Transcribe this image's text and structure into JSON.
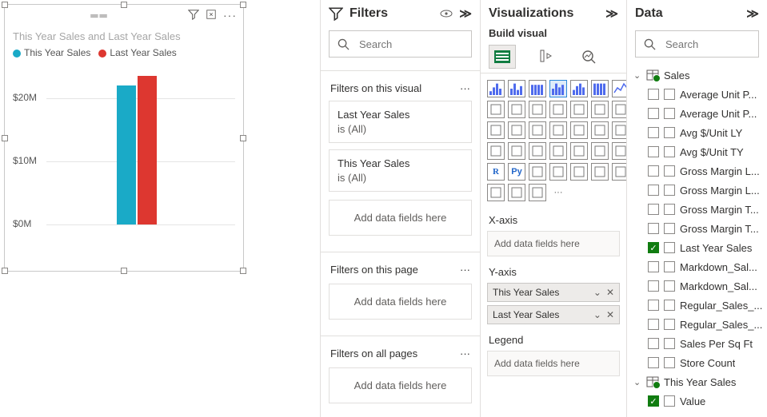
{
  "chart_data": {
    "type": "bar",
    "title": "This Year Sales and Last Year Sales",
    "series": [
      {
        "name": "This Year Sales",
        "values": [
          22
        ],
        "color": "#1aaac7"
      },
      {
        "name": "Last Year Sales",
        "values": [
          23.5
        ],
        "color": "#dd3730"
      }
    ],
    "categories": [
      ""
    ],
    "ylabel": "",
    "ylim": [
      0,
      25
    ],
    "yticks": [
      {
        "v": 0,
        "label": "$0M"
      },
      {
        "v": 10,
        "label": "$10M"
      },
      {
        "v": 20,
        "label": "$20M"
      }
    ]
  },
  "filters": {
    "pane_title": "Filters",
    "search_placeholder": "Search",
    "sections": {
      "visual": {
        "title": "Filters on this visual",
        "cards": [
          {
            "field": "Last Year Sales",
            "summary": "is (All)"
          },
          {
            "field": "This Year Sales",
            "summary": "is (All)"
          }
        ],
        "drop_text": "Add data fields here"
      },
      "page": {
        "title": "Filters on this page",
        "drop_text": "Add data fields here"
      },
      "all": {
        "title": "Filters on all pages",
        "drop_text": "Add data fields here"
      }
    }
  },
  "viz": {
    "pane_title": "Visualizations",
    "subtitle": "Build visual",
    "xaxis_title": "X-axis",
    "xaxis_drop": "Add data fields here",
    "yaxis_title": "Y-axis",
    "yaxis_fields": [
      "This Year Sales",
      "Last Year Sales"
    ],
    "legend_title": "Legend",
    "legend_drop": "Add data fields here"
  },
  "data": {
    "pane_title": "Data",
    "search_placeholder": "Search",
    "tables": [
      {
        "name": "Sales",
        "expanded": true,
        "fields": [
          {
            "name": "Average Unit P...",
            "checked": false
          },
          {
            "name": "Average Unit P...",
            "checked": false
          },
          {
            "name": "Avg $/Unit LY",
            "checked": false
          },
          {
            "name": "Avg $/Unit TY",
            "checked": false
          },
          {
            "name": "Gross Margin L...",
            "checked": false
          },
          {
            "name": "Gross Margin L...",
            "checked": false
          },
          {
            "name": "Gross Margin T...",
            "checked": false
          },
          {
            "name": "Gross Margin T...",
            "checked": false
          },
          {
            "name": "Last Year Sales",
            "checked": true
          },
          {
            "name": "Markdown_Sal...",
            "checked": false
          },
          {
            "name": "Markdown_Sal...",
            "checked": false
          },
          {
            "name": "Regular_Sales_...",
            "checked": false
          },
          {
            "name": "Regular_Sales_...",
            "checked": false
          },
          {
            "name": "Sales Per Sq Ft",
            "checked": false
          },
          {
            "name": "Store Count",
            "checked": false
          }
        ]
      },
      {
        "name": "This Year Sales",
        "expanded": true,
        "fields": [
          {
            "name": "Value",
            "checked": true
          }
        ]
      }
    ]
  }
}
